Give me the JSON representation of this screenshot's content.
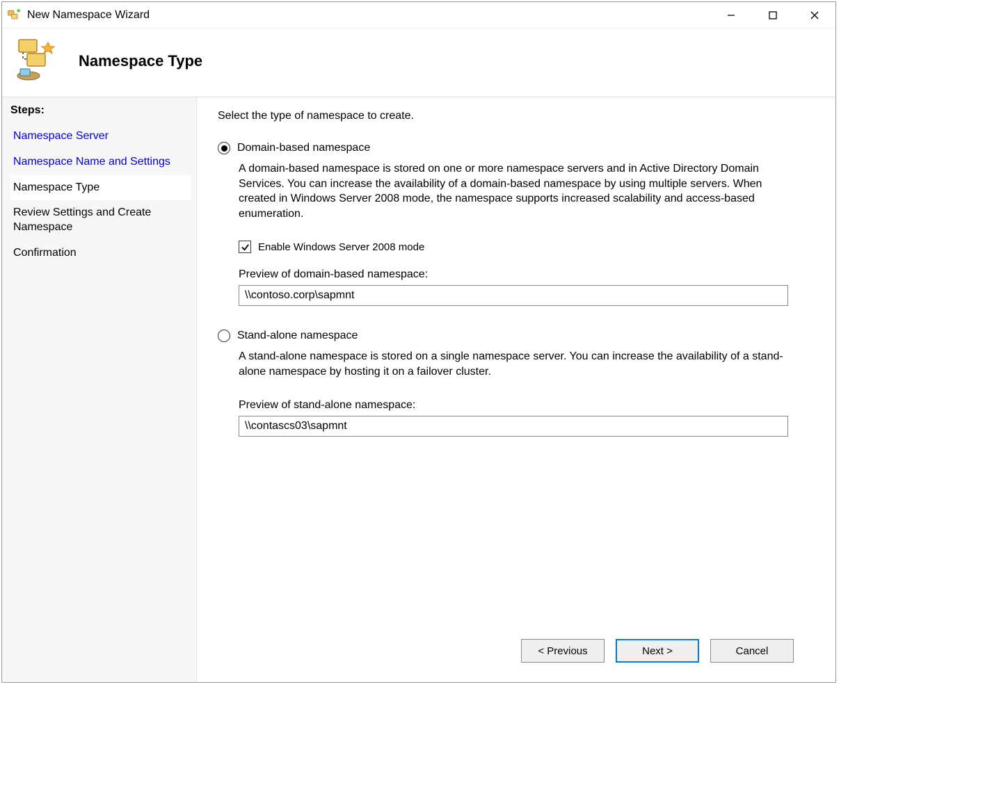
{
  "window": {
    "title": "New Namespace Wizard"
  },
  "header": {
    "title": "Namespace Type"
  },
  "sidebar": {
    "label": "Steps:",
    "steps": [
      {
        "label": "Namespace Server",
        "state": "link"
      },
      {
        "label": "Namespace Name and Settings",
        "state": "link"
      },
      {
        "label": "Namespace Type",
        "state": "current"
      },
      {
        "label": "Review Settings and Create Namespace",
        "state": "plain"
      },
      {
        "label": "Confirmation",
        "state": "plain"
      }
    ]
  },
  "content": {
    "intro": "Select the type of namespace to create.",
    "domain": {
      "radio_label": "Domain-based namespace",
      "selected": true,
      "description": "A domain-based namespace is stored on one or more namespace servers and in Active Directory Domain Services. You can increase the availability of a domain-based namespace by using multiple servers. When created in Windows Server 2008 mode, the namespace supports increased scalability and access-based enumeration.",
      "checkbox_label": "Enable Windows Server 2008 mode",
      "checkbox_checked": true,
      "preview_label": "Preview of domain-based namespace:",
      "preview_value": "\\\\contoso.corp\\sapmnt"
    },
    "standalone": {
      "radio_label": "Stand-alone namespace",
      "selected": false,
      "description": "A stand-alone namespace is stored on a single namespace server. You can increase the availability of a stand-alone namespace by hosting it on a failover cluster.",
      "preview_label": "Preview of stand-alone namespace:",
      "preview_value": "\\\\contascs03\\sapmnt"
    }
  },
  "footer": {
    "previous": "< Previous",
    "next": "Next >",
    "cancel": "Cancel"
  }
}
